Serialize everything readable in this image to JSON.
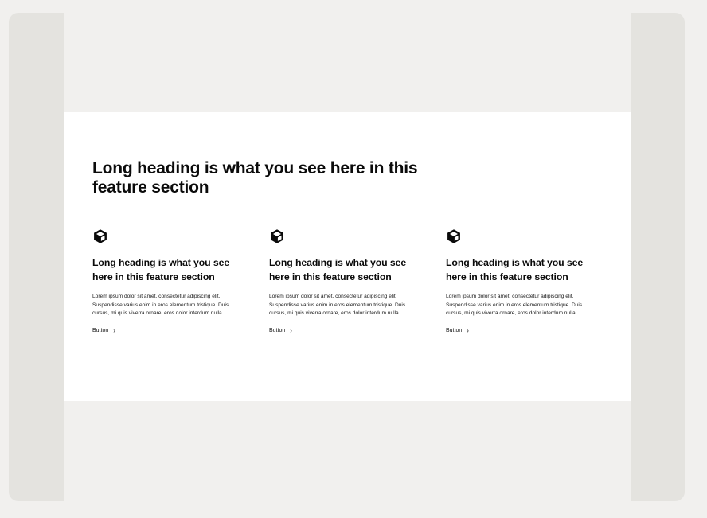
{
  "section": {
    "heading": "Long heading is what you see here in this feature section"
  },
  "features": [
    {
      "icon": "cube-icon",
      "title": "Long heading is what you see here in this feature section",
      "body": "Lorem ipsum dolor sit amet, consectetur adipiscing elit. Suspendisse varius enim in eros elementum tristique. Duis cursus, mi quis viverra ornare, eros dolor interdum nulla.",
      "button_label": "Button",
      "button_icon": "chevron-right-icon"
    },
    {
      "icon": "cube-icon",
      "title": "Long heading is what you see here in this feature section",
      "body": "Lorem ipsum dolor sit amet, consectetur adipiscing elit. Suspendisse varius enim in eros elementum tristique. Duis cursus, mi quis viverra ornare, eros dolor interdum nulla.",
      "button_label": "Button",
      "button_icon": "chevron-right-icon"
    },
    {
      "icon": "cube-icon",
      "title": "Long heading is what you see here in this feature section",
      "body": "Lorem ipsum dolor sit amet, consectetur adipiscing elit. Suspendisse varius enim in eros elementum tristique. Duis cursus, mi quis viverra ornare, eros dolor interdum nulla.",
      "button_label": "Button",
      "button_icon": "chevron-right-icon"
    }
  ]
}
